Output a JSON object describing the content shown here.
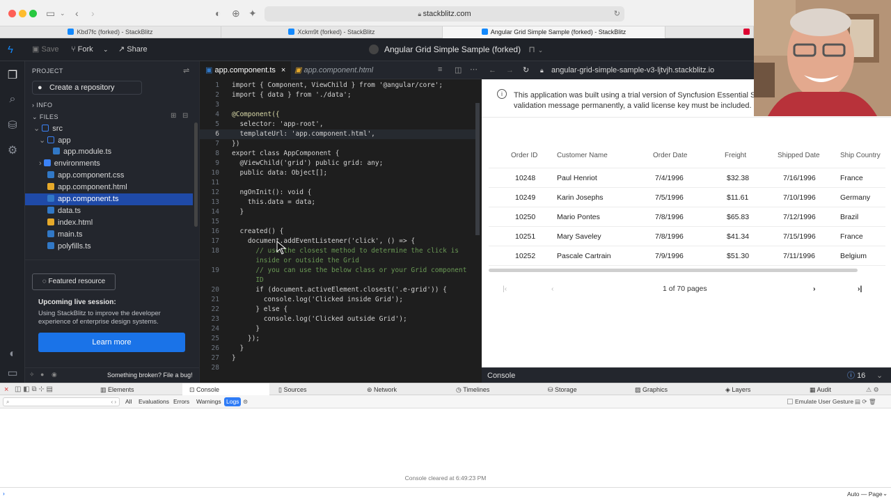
{
  "browser": {
    "url": "stackblitz.com",
    "tabs": [
      {
        "title": "Kbd7fc (forked) - StackBlitz"
      },
      {
        "title": "Xckm9t (forked) - StackBlitz"
      },
      {
        "title": "Angular Grid Simple Sample (forked) - StackBlitz"
      }
    ]
  },
  "header": {
    "save_label": "Save",
    "fork_label": "Fork",
    "share_label": "Share",
    "project_title": "Angular Grid Simple Sample (forked)"
  },
  "sidebar": {
    "project_label": "PROJECT",
    "create_repo_label": "Create a repository",
    "info_label": "INFO",
    "files_label": "FILES",
    "tree": [
      {
        "label": "src"
      },
      {
        "label": "app"
      },
      {
        "label": "app.module.ts"
      },
      {
        "label": "environments"
      },
      {
        "label": "app.component.css"
      },
      {
        "label": "app.component.html"
      },
      {
        "label": "app.component.ts"
      },
      {
        "label": "data.ts"
      },
      {
        "label": "index.html"
      },
      {
        "label": "main.ts"
      },
      {
        "label": "polyfills.ts"
      }
    ],
    "featured_label": "Featured resource",
    "upcoming_title": "Upcoming live session:",
    "upcoming_text": "Using StackBlitz to improve the developer experience of enterprise design systems.",
    "learn_more_label": "Learn more",
    "broken_label": "Something broken? File a bug!"
  },
  "editor": {
    "tabs": [
      {
        "label": "app.component.ts"
      },
      {
        "label": "app.component.html"
      }
    ],
    "lines": [
      {
        "n": "1"
      },
      {
        "n": "2"
      },
      {
        "n": "3"
      },
      {
        "n": "4"
      },
      {
        "n": "5"
      },
      {
        "n": "6"
      },
      {
        "n": "7"
      },
      {
        "n": "8"
      },
      {
        "n": "9"
      },
      {
        "n": "10"
      },
      {
        "n": "11"
      },
      {
        "n": "12"
      },
      {
        "n": "13"
      },
      {
        "n": "14"
      },
      {
        "n": "15"
      },
      {
        "n": "16"
      },
      {
        "n": "17"
      },
      {
        "n": "18"
      },
      {
        "n": "19"
      },
      {
        "n": "20"
      },
      {
        "n": "21"
      },
      {
        "n": "22"
      },
      {
        "n": "23"
      },
      {
        "n": "24"
      },
      {
        "n": "25"
      },
      {
        "n": "26"
      },
      {
        "n": "27"
      },
      {
        "n": "28"
      }
    ],
    "code": {
      "l1": "import { Component, ViewChild } from '@angular/core';",
      "l2": "import { data } from './data';",
      "l4": "@Component({",
      "l5": "  selector: 'app-root',",
      "l6": "  templateUrl: 'app.component.html',",
      "l7": "})",
      "l8": "export class AppComponent {",
      "l9": "  @ViewChild('grid') public grid: any;",
      "l10": "  public data: Object[];",
      "l12": "  ngOnInit(): void {",
      "l13": "    this.data = data;",
      "l14": "  }",
      "l16": "  created() {",
      "l17": "    document.addEventListener('click', () => {",
      "l18a": "      // use the closest method to determine the click is",
      "l18b": "      inside or outside the Grid",
      "l19a": "      // you can use the below class or your Grid component",
      "l19b": "      ID",
      "l20": "      if (document.activeElement.closest('.e-grid')) {",
      "l21": "        console.log('Clicked inside Grid');",
      "l22": "      } else {",
      "l23": "        console.log('Clicked outside Grid');",
      "l24": "      }",
      "l25": "    });",
      "l26": "  }",
      "l27": "}"
    }
  },
  "preview": {
    "url": "angular-grid-simple-sample-v3-ljtvjh.stackblitz.io",
    "license_line1": "This application was built using a trial version of Syncfusion Essential St",
    "license_line2": "validation message permanently, a valid license key must be included.",
    "license_link": "Cl",
    "grid": {
      "headers": [
        "Order ID",
        "Customer Name",
        "Order Date",
        "Freight",
        "Shipped Date",
        "Ship Country"
      ],
      "rows": [
        [
          "10248",
          "Paul Henriot",
          "7/4/1996",
          "$32.38",
          "7/16/1996",
          "France"
        ],
        [
          "10249",
          "Karin Josephs",
          "7/5/1996",
          "$11.61",
          "7/10/1996",
          "Germany"
        ],
        [
          "10250",
          "Mario Pontes",
          "7/8/1996",
          "$65.83",
          "7/12/1996",
          "Brazil"
        ],
        [
          "10251",
          "Mary Saveley",
          "7/8/1996",
          "$41.34",
          "7/15/1996",
          "France"
        ],
        [
          "10252",
          "Pascale Cartrain",
          "7/9/1996",
          "$51.30",
          "7/11/1996",
          "Belgium"
        ]
      ]
    },
    "pager_text": "1 of 70 pages",
    "console_label": "Console",
    "console_count": "16"
  },
  "inspector": {
    "tabs": [
      "Elements",
      "Console",
      "Sources",
      "Network",
      "Timelines",
      "Storage",
      "Graphics",
      "Layers",
      "Audit"
    ],
    "filters": [
      "All",
      "Evaluations",
      "Errors",
      "Warnings",
      "Logs"
    ],
    "emulate_label": "Emulate User Gesture",
    "cleared_message": "Console cleared at 6:49:23 PM",
    "auto_page_label": "Auto — Page"
  },
  "colors": {
    "accent_blue": "#1a73e8",
    "selected_file": "#1f4aa8",
    "ts_icon": "#3178c6",
    "html_icon": "#e6a92a",
    "folder_icon": "#3b82f6"
  }
}
